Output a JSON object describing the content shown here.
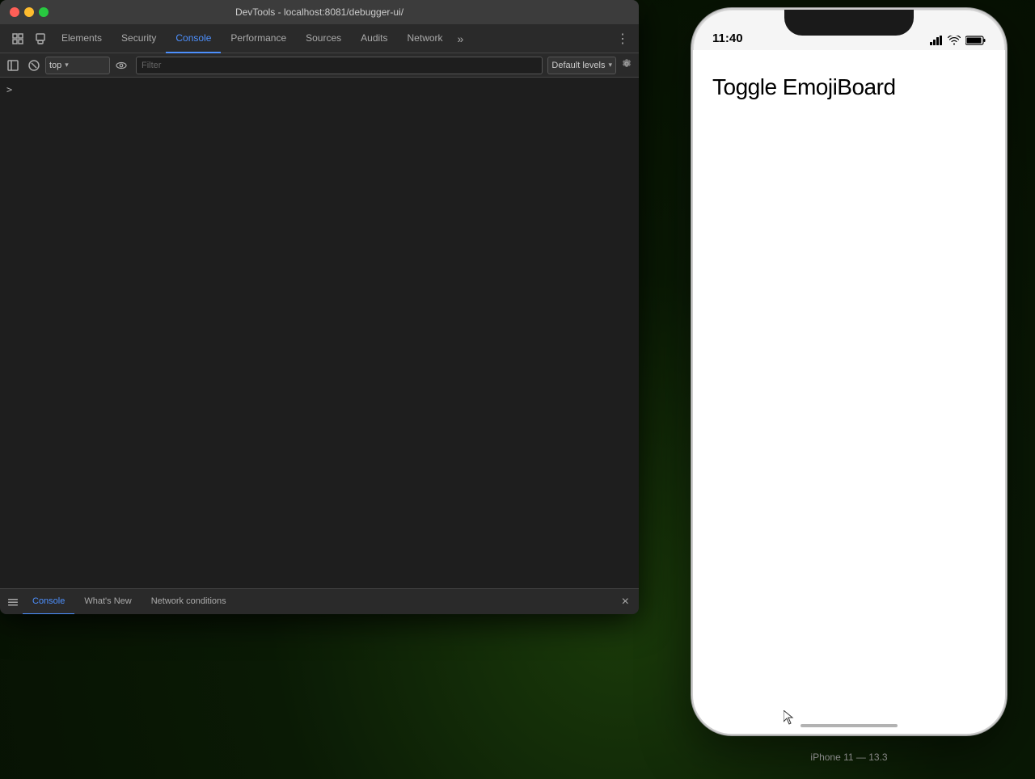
{
  "window": {
    "title": "DevTools - localhost:8081/debugger-ui/"
  },
  "devtools": {
    "tabs": [
      {
        "id": "elements",
        "label": "Elements",
        "active": false
      },
      {
        "id": "security",
        "label": "Security",
        "active": false
      },
      {
        "id": "console",
        "label": "Console",
        "active": true
      },
      {
        "id": "performance",
        "label": "Performance",
        "active": false
      },
      {
        "id": "sources",
        "label": "Sources",
        "active": false
      },
      {
        "id": "audits",
        "label": "Audits",
        "active": false
      },
      {
        "id": "network",
        "label": "Network",
        "active": false
      }
    ],
    "overflow_label": "»",
    "more_options_label": "⋮",
    "toolbar": {
      "context_value": "top",
      "filter_placeholder": "Filter",
      "levels_label": "Default levels",
      "levels_arrow": "▾"
    },
    "drawer": {
      "tabs": [
        {
          "id": "console-drawer",
          "label": "Console",
          "active": true
        },
        {
          "id": "whats-new",
          "label": "What's New",
          "active": false
        },
        {
          "id": "network-conditions",
          "label": "Network conditions",
          "active": false
        }
      ],
      "close_label": "×"
    }
  },
  "iphone": {
    "time": "11:40",
    "model_label": "iPhone 11 — 13.3",
    "app_title": "Toggle EmojiBoard",
    "home_indicator": true
  },
  "icons": {
    "inspect": "⬚",
    "device": "⧉",
    "panel_left": "◫",
    "no_entry": "🚫",
    "eye": "◉",
    "gear": "⚙",
    "chevron_down": "▾",
    "wifi": "▲",
    "battery": "▮▮▮",
    "signal": "●●●",
    "drawer_toggle": "≡",
    "close": "×",
    "prompt": ">"
  }
}
